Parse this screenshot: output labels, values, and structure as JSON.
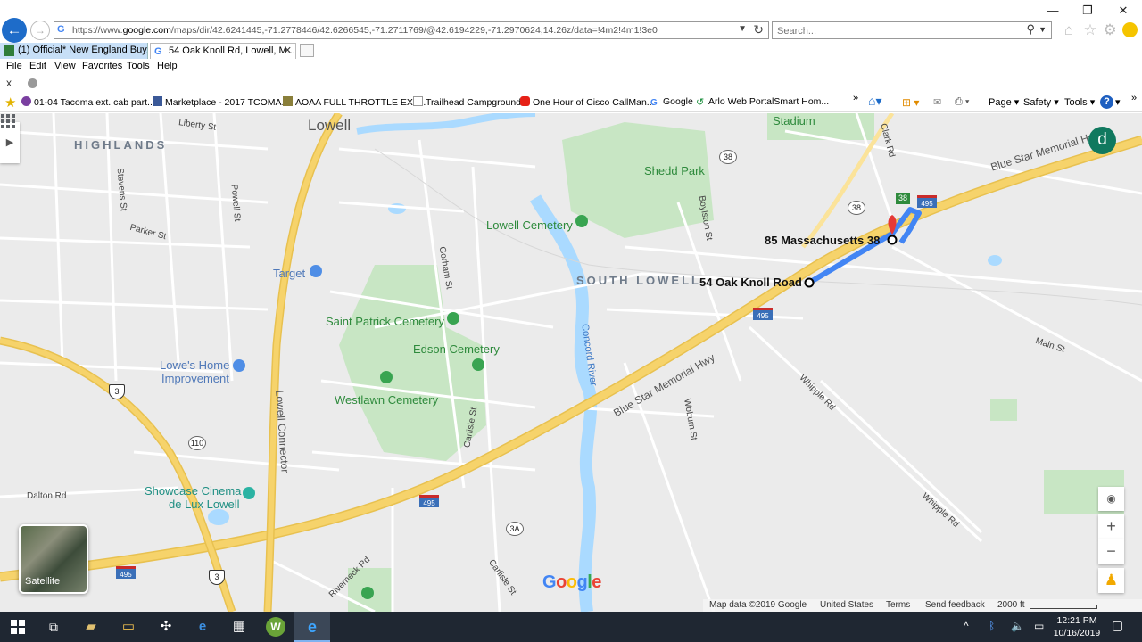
{
  "window": {
    "minimize": "—",
    "maximize": "❐",
    "close": "✕"
  },
  "address_bar": {
    "url_prefix": "https://www.",
    "url_domain": "google.com",
    "url_rest": "/maps/dir/42.6241445,-71.2778446/42.6266545,-71.2711769/@42.6194229,-71.2970624,14.26z/data=!4m2!4m1!3e0",
    "search_placeholder": "Search..."
  },
  "tabs": [
    {
      "label": "(1) Official* New England Buy/..."
    },
    {
      "label": "54 Oak Knoll Rd, Lowell, M...",
      "close": "✕"
    }
  ],
  "menu": [
    "File",
    "Edit",
    "View",
    "Favorites",
    "Tools",
    "Help"
  ],
  "find_bar": {
    "close": "x"
  },
  "favorites": [
    {
      "label": "01-04 Tacoma ext. cab part..."
    },
    {
      "label": "Marketplace - 2017 TCOMA..."
    },
    {
      "label": "AOAA FULL THROTTLE EXP..."
    },
    {
      "label": "Trailhead Campground"
    },
    {
      "label": "One Hour of Cisco CallMan..."
    },
    {
      "label": "Google"
    },
    {
      "label": "Arlo Web PortalSmart Hom..."
    }
  ],
  "command_bar": {
    "more": "»",
    "page": "Page ▾",
    "safety": "Safety ▾",
    "tools": "Tools ▾"
  },
  "map": {
    "area_labels": [
      "HIGHLANDS",
      "SOUTH LOWELL"
    ],
    "city": "Lowell",
    "streets": [
      "Liberty St",
      "Stevens St",
      "Powell St",
      "Parker St",
      "Gorham St",
      "Boylston St",
      "Clark Rd",
      "Main St",
      "Whipple Rd",
      "Whipple Rd",
      "Woburn St",
      "Carlisle St",
      "Carlisle St",
      "Riverneck Rd",
      "Dalton Rd"
    ],
    "highways": [
      "Blue Star Memorial Hwy",
      "Blue Star Memorial Hwy",
      "Lowell Connector"
    ],
    "parks": [
      "Shedd Park",
      "Lowell Cemetery",
      "Saint Patrick Cemetery",
      "Edson Cemetery",
      "Westlawn Cemetery"
    ],
    "pois": [
      "Stadium",
      "Target",
      "Lowe's Home",
      "Improvement",
      "Showcase Cinema",
      "de Lux Lowell"
    ],
    "river": "Concord River",
    "route": {
      "origin": "54 Oak Knoll Road",
      "destination": "85 Massachusetts 38"
    },
    "shields": {
      "i495": "495",
      "rt38": "38",
      "rt110": "110",
      "us3": "3",
      "rt3a": "3A"
    },
    "account_initial": "d",
    "satellite_label": "Satellite",
    "zoom_in": "+",
    "zoom_out": "−",
    "logo": "Google",
    "footer": {
      "map_data": "Map data ©2019 Google",
      "country": "United States",
      "terms": "Terms",
      "feedback": "Send feedback",
      "scale": "2000 ft"
    },
    "colors": {
      "route": "#4285f4",
      "highway": "#f6d36b",
      "water": "#aadaff",
      "park": "#c8e6c4",
      "pin": "#e53935"
    }
  },
  "taskbar": {
    "time": "12:21 PM",
    "date": "10/16/2019"
  }
}
